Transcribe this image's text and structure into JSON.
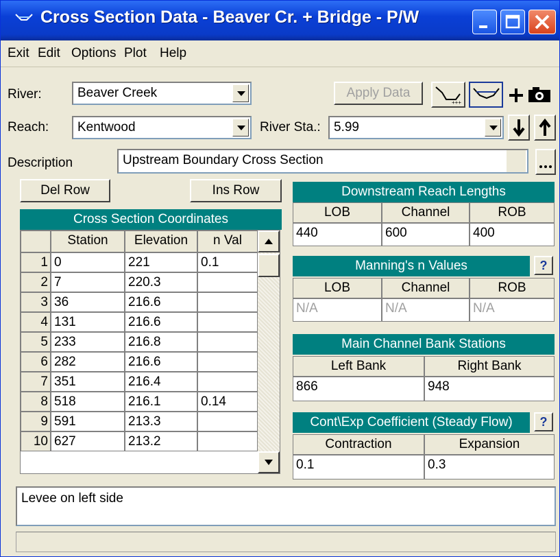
{
  "window": {
    "title": "Cross Section Data - Beaver Cr. + Bridge - P/W"
  },
  "menu": [
    "Exit",
    "Edit",
    "Options",
    "Plot",
    "Help"
  ],
  "river": {
    "label": "River:",
    "value": "Beaver Creek"
  },
  "reach": {
    "label": "Reach:",
    "value": "Kentwood"
  },
  "river_sta": {
    "label": "River Sta.:",
    "value": "5.99"
  },
  "apply_data": "Apply Data",
  "description": {
    "label": "Description",
    "value": "Upstream Boundary Cross Section"
  },
  "del_row": "Del Row",
  "ins_row": "Ins Row",
  "coords": {
    "title": "Cross Section Coordinates",
    "headers": [
      "Station",
      "Elevation",
      "n Val"
    ],
    "rows": [
      {
        "n": "1",
        "station": "0",
        "elev": "221",
        "nval": "0.1"
      },
      {
        "n": "2",
        "station": "7",
        "elev": "220.3",
        "nval": ""
      },
      {
        "n": "3",
        "station": "36",
        "elev": "216.6",
        "nval": ""
      },
      {
        "n": "4",
        "station": "131",
        "elev": "216.6",
        "nval": ""
      },
      {
        "n": "5",
        "station": "233",
        "elev": "216.8",
        "nval": ""
      },
      {
        "n": "6",
        "station": "282",
        "elev": "216.6",
        "nval": ""
      },
      {
        "n": "7",
        "station": "351",
        "elev": "216.4",
        "nval": ""
      },
      {
        "n": "8",
        "station": "518",
        "elev": "216.1",
        "nval": "0.14"
      },
      {
        "n": "9",
        "station": "591",
        "elev": "213.3",
        "nval": ""
      },
      {
        "n": "10",
        "station": "627",
        "elev": "213.2",
        "nval": ""
      }
    ]
  },
  "reach_lengths": {
    "title": "Downstream Reach Lengths",
    "headers": [
      "LOB",
      "Channel",
      "ROB"
    ],
    "values": [
      "440",
      "600",
      "400"
    ]
  },
  "mannings": {
    "title": "Manning's n Values",
    "headers": [
      "LOB",
      "Channel",
      "ROB"
    ],
    "values": [
      "N/A",
      "N/A",
      "N/A"
    ]
  },
  "bank_stations": {
    "title": "Main Channel Bank Stations",
    "headers": [
      "Left Bank",
      "Right Bank"
    ],
    "values": [
      "866",
      "948"
    ]
  },
  "coefficients": {
    "title": "Cont\\Exp Coefficient (Steady Flow)",
    "headers": [
      "Contraction",
      "Expansion"
    ],
    "values": [
      "0.1",
      "0.3"
    ]
  },
  "notes": "Levee on left side",
  "help_glyph": "?",
  "icons": [
    "xs-shape-icon",
    "xs-water-icon",
    "plus-icon",
    "camera-icon",
    "down-arrow-icon",
    "up-arrow-icon",
    "minimize-icon",
    "maximize-icon",
    "close-icon",
    "ellipsis-icon"
  ],
  "colors": {
    "section_header": "#008080",
    "titlebar": "#0a3fd6",
    "close": "#d9421c",
    "window_bg": "#ece9d8"
  }
}
